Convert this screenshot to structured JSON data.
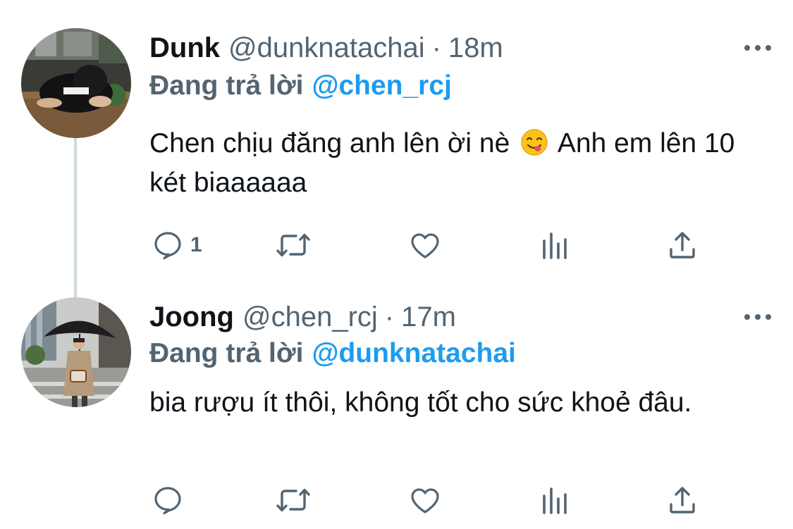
{
  "tweets": [
    {
      "display_name": "Dunk",
      "handle": "@dunknatachai",
      "separator": "·",
      "time": "18m",
      "reply_prefix": "Đang trả lời",
      "reply_to": "@chen_rcj",
      "text_before_emoji": "Chen chịu đăng anh lên ời nè",
      "emoji": "savoring-food-emoji",
      "text_after_emoji": " Anh em lên 10 két biaaaaaa",
      "reply_count": "1",
      "retweet_count": "",
      "like_count": "",
      "view_count": ""
    },
    {
      "display_name": "Joong",
      "handle": "@chen_rcj",
      "separator": "·",
      "time": "17m",
      "reply_prefix": "Đang trả lời",
      "reply_to": "@dunknatachai",
      "text": "bia rượu ít thôi, không tốt cho sức khoẻ đâu.",
      "reply_count": "",
      "retweet_count": "",
      "like_count": "",
      "view_count": ""
    }
  ],
  "icons": {
    "reply": "speech-bubble-icon",
    "retweet": "retweet-arrows-icon",
    "like": "heart-icon",
    "views": "bar-chart-icon",
    "share": "share-upload-icon",
    "more": "ellipsis-icon"
  },
  "colors": {
    "accent": "#1d9bf0",
    "secondary_text": "#536471",
    "primary_text": "#0f1419",
    "thread_line": "#cfd9de"
  }
}
